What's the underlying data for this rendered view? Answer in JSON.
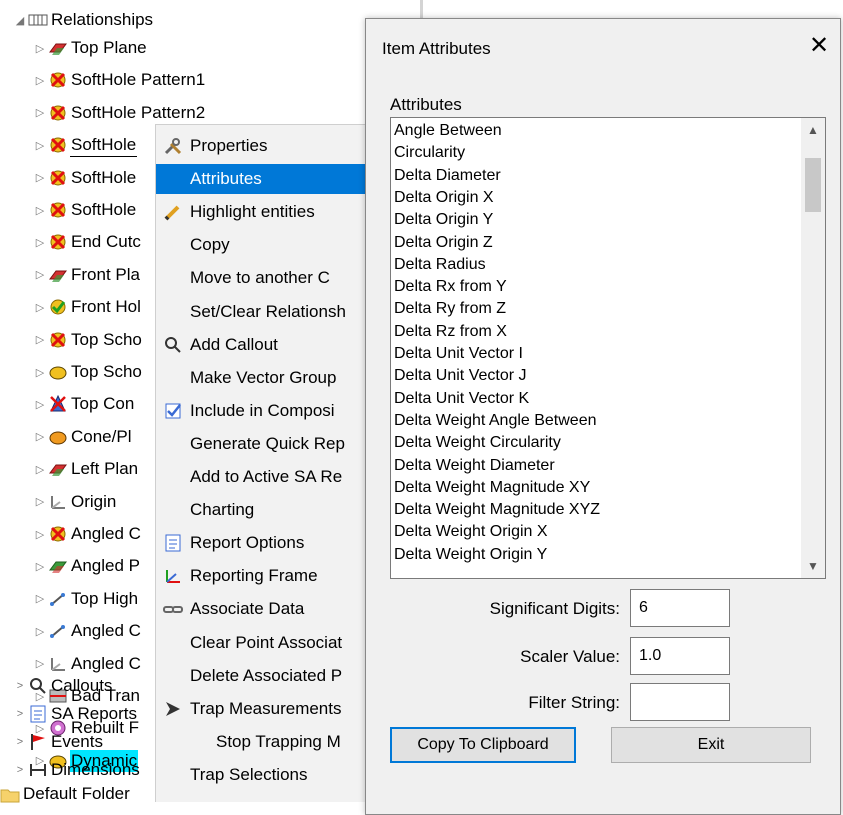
{
  "tree": {
    "root_label": "Relationships",
    "items": [
      {
        "label": "Top Plane",
        "icon": "plane-red-icon"
      },
      {
        "label": "SoftHole Pattern1",
        "icon": "warning-circle-icon"
      },
      {
        "label": "SoftHole Pattern2",
        "icon": "warning-circle-icon"
      },
      {
        "label": "SoftHole",
        "icon": "warning-circle-icon"
      },
      {
        "label": "SoftHole",
        "icon": "warning-circle-icon"
      },
      {
        "label": "SoftHole",
        "icon": "warning-circle-icon"
      },
      {
        "label": "End Cutc",
        "icon": "warning-circle-icon"
      },
      {
        "label": "Front Pla",
        "icon": "plane-red-icon"
      },
      {
        "label": "Front Hol",
        "icon": "check-circle-icon"
      },
      {
        "label": "Top Scho",
        "icon": "warning-circle-icon"
      },
      {
        "label": "Top Scho",
        "icon": "circle-yellow-icon"
      },
      {
        "label": "Top Con",
        "icon": "cone-icon"
      },
      {
        "label": "Cone/Pl",
        "icon": "circle-orange-icon"
      },
      {
        "label": "Left Plan",
        "icon": "plane-red-icon"
      },
      {
        "label": "Origin",
        "icon": "frame-icon"
      },
      {
        "label": "Angled C",
        "icon": "warning-circle-icon"
      },
      {
        "label": "Angled P",
        "icon": "plane-green-icon"
      },
      {
        "label": "Top High",
        "icon": "line-icon"
      },
      {
        "label": "Angled C",
        "icon": "line-icon"
      },
      {
        "label": "Angled C",
        "icon": "frame-icon"
      },
      {
        "label": "Bad Tran",
        "icon": "transform-icon"
      },
      {
        "label": "Rebuilt F",
        "icon": "rebuild-icon"
      },
      {
        "label": "Dynamic",
        "icon": "circle-yellow-icon",
        "highlight": true
      }
    ],
    "bottom_items": [
      {
        "label": "Callouts",
        "icon": "callout-icon"
      },
      {
        "label": "SA Reports",
        "icon": "report-icon"
      },
      {
        "label": "Events",
        "icon": "flag-icon"
      },
      {
        "label": "Dimensions",
        "icon": "dimension-icon"
      }
    ],
    "folder_label": "Default Folder"
  },
  "context_menu": {
    "items": [
      {
        "label": "Properties",
        "icon": "tools-icon"
      },
      {
        "label": "Attributes",
        "icon": "",
        "active": true
      },
      {
        "label": "Highlight entities",
        "icon": "pencil-icon"
      },
      {
        "label": "Copy",
        "icon": ""
      },
      {
        "label": "Move to another C",
        "icon": ""
      },
      {
        "label": "Set/Clear Relationsh",
        "icon": ""
      },
      {
        "label": "Add Callout",
        "icon": "callout-icon"
      },
      {
        "label": "Make Vector Group",
        "icon": ""
      },
      {
        "label": "Include in Composi",
        "icon": "checklist-icon"
      },
      {
        "label": "Generate Quick Rep",
        "icon": ""
      },
      {
        "label": "Add to Active SA Re",
        "icon": ""
      },
      {
        "label": "Charting",
        "icon": ""
      },
      {
        "label": "Report Options",
        "icon": "report-icon"
      },
      {
        "label": "Reporting Frame",
        "icon": "axes-icon"
      },
      {
        "label": "Associate Data",
        "icon": "link-icon"
      },
      {
        "label": "Clear Point Associat",
        "icon": ""
      },
      {
        "label": "Delete Associated P",
        "icon": ""
      },
      {
        "label": "Trap Measurements",
        "icon": "arrow-icon"
      },
      {
        "label": "Stop Trapping M",
        "icon": "",
        "indent": true
      },
      {
        "label": "Trap Selections",
        "icon": ""
      }
    ]
  },
  "dialog": {
    "title": "Item Attributes",
    "close_symbol": "✕",
    "list_label": "Attributes",
    "attributes": [
      "Angle Between",
      "Circularity",
      "Delta Diameter",
      "Delta Origin X",
      "Delta Origin Y",
      "Delta Origin Z",
      "Delta Radius",
      "Delta Rx from Y",
      "Delta Ry from Z",
      "Delta Rz from X",
      "Delta Unit Vector I",
      "Delta Unit Vector J",
      "Delta Unit Vector K",
      "Delta Weight Angle Between",
      "Delta Weight Circularity",
      "Delta Weight Diameter",
      "Delta Weight Magnitude XY",
      "Delta Weight Magnitude XYZ",
      "Delta Weight Origin X",
      "Delta Weight Origin Y"
    ],
    "scroll_up": "▲",
    "scroll_down": "▼",
    "significant_digits_label": "Significant Digits:",
    "significant_digits_value": "6",
    "scaler_value_label": "Scaler Value:",
    "scaler_value_value": "1.0",
    "filter_string_label": "Filter String:",
    "filter_string_value": "",
    "copy_button": "Copy To Clipboard",
    "exit_button": "Exit",
    "accent_color": "#0078d7"
  }
}
